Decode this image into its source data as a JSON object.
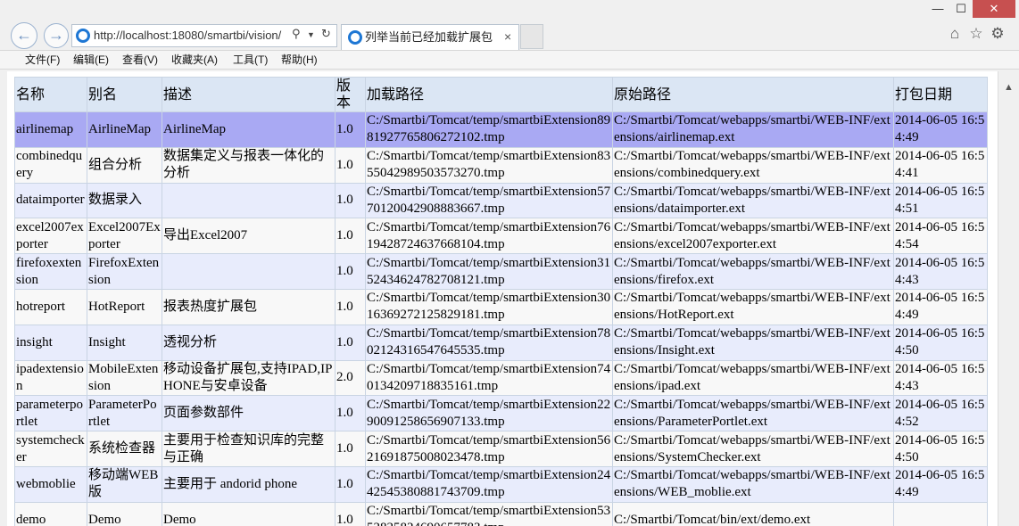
{
  "window": {
    "min_label": "—",
    "max_label": "☐",
    "close_label": "✕"
  },
  "nav": {
    "back_icon": "arrow-left-icon",
    "forward_icon": "arrow-right-icon",
    "address": "http://localhost:18080/smartbi/vision/",
    "tab_title": "列举当前已经加载扩展包"
  },
  "menu": [
    "文件(F)",
    "编辑(E)",
    "查看(V)",
    "收藏夹(A)",
    "工具(T)",
    "帮助(H)"
  ],
  "table": {
    "headers": [
      "名称",
      "别名",
      "描述",
      "版本",
      "加载路径",
      "原始路径",
      "打包日期"
    ],
    "rows": [
      [
        "airlinemap",
        "AirlineMap",
        "AirlineMap",
        "1.0",
        "C:/Smartbi/Tomcat/temp/smartbiExtension8981927765806272102.tmp",
        "C:/Smartbi/Tomcat/webapps/smartbi/WEB-INF/extensions/airlinemap.ext",
        "2014-06-05 16:54:49"
      ],
      [
        "combinedquery",
        "组合分析",
        "数据集定义与报表一体化的分析",
        "1.0",
        "C:/Smartbi/Tomcat/temp/smartbiExtension8355042989503573270.tmp",
        "C:/Smartbi/Tomcat/webapps/smartbi/WEB-INF/extensions/combinedquery.ext",
        "2014-06-05 16:54:41"
      ],
      [
        "dataimporter",
        "数据录入",
        "",
        "1.0",
        "C:/Smartbi/Tomcat/temp/smartbiExtension5770120042908883667.tmp",
        "C:/Smartbi/Tomcat/webapps/smartbi/WEB-INF/extensions/dataimporter.ext",
        "2014-06-05 16:54:51"
      ],
      [
        "excel2007exporter",
        "Excel2007Exporter",
        "导出Excel2007",
        "1.0",
        "C:/Smartbi/Tomcat/temp/smartbiExtension7619428724637668104.tmp",
        "C:/Smartbi/Tomcat/webapps/smartbi/WEB-INF/extensions/excel2007exporter.ext",
        "2014-06-05 16:54:54"
      ],
      [
        "firefoxextension",
        "FirefoxExtension",
        "",
        "1.0",
        "C:/Smartbi/Tomcat/temp/smartbiExtension3152434624782708121.tmp",
        "C:/Smartbi/Tomcat/webapps/smartbi/WEB-INF/extensions/firefox.ext",
        "2014-06-05 16:54:43"
      ],
      [
        "hotreport",
        "HotReport",
        "报表热度扩展包",
        "1.0",
        "C:/Smartbi/Tomcat/temp/smartbiExtension3016369272125829181.tmp",
        "C:/Smartbi/Tomcat/webapps/smartbi/WEB-INF/extensions/HotReport.ext",
        "2014-06-05 16:54:49"
      ],
      [
        "insight",
        "Insight",
        "透视分析",
        "1.0",
        "C:/Smartbi/Tomcat/temp/smartbiExtension7802124316547645535.tmp",
        "C:/Smartbi/Tomcat/webapps/smartbi/WEB-INF/extensions/Insight.ext",
        "2014-06-05 16:54:50"
      ],
      [
        "ipadextension",
        "MobileExtension",
        "移动设备扩展包,支持IPAD,IPHONE与安卓设备",
        "2.0",
        "C:/Smartbi/Tomcat/temp/smartbiExtension740134209718835161.tmp",
        "C:/Smartbi/Tomcat/webapps/smartbi/WEB-INF/extensions/ipad.ext",
        "2014-06-05 16:54:43"
      ],
      [
        "parameterportlet",
        "ParameterPortlet",
        "页面参数部件",
        "1.0",
        "C:/Smartbi/Tomcat/temp/smartbiExtension2290091258656907133.tmp",
        "C:/Smartbi/Tomcat/webapps/smartbi/WEB-INF/extensions/ParameterPortlet.ext",
        "2014-06-05 16:54:52"
      ],
      [
        "systemchecker",
        "系统检查器",
        "主要用于检查知识库的完整与正确",
        "1.0",
        "C:/Smartbi/Tomcat/temp/smartbiExtension5621691875008023478.tmp",
        "C:/Smartbi/Tomcat/webapps/smartbi/WEB-INF/extensions/SystemChecker.ext",
        "2014-06-05 16:54:50"
      ],
      [
        "webmoblie",
        "移动端WEB版",
        "主要用于 andorid phone",
        "1.0",
        "C:/Smartbi/Tomcat/temp/smartbiExtension2442545380881743709.tmp",
        "C:/Smartbi/Tomcat/webapps/smartbi/WEB-INF/extensions/WEB_moblie.ext",
        "2014-06-05 16:54:49"
      ],
      [
        "demo",
        "Demo",
        "Demo",
        "1.0",
        "C:/Smartbi/Tomcat/temp/smartbiExtension5352825824690657783.tmp",
        "C:/Smartbi/Tomcat/bin/ext/demo.ext",
        ""
      ]
    ]
  }
}
